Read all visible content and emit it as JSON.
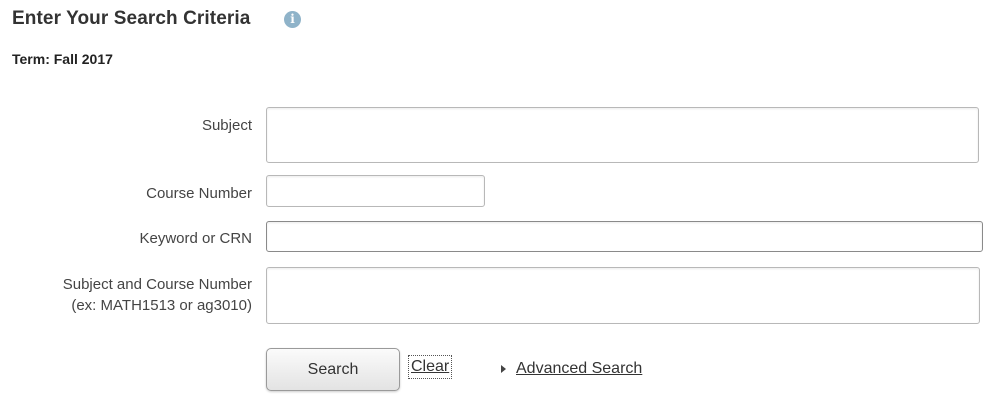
{
  "header": {
    "title": "Enter Your Search Criteria",
    "info_icon": "info-icon"
  },
  "term": {
    "text": "Term: Fall 2017"
  },
  "form": {
    "subject": {
      "label": "Subject",
      "value": ""
    },
    "course_number": {
      "label": "Course Number",
      "value": ""
    },
    "keyword": {
      "label": "Keyword or CRN",
      "value": ""
    },
    "subject_course": {
      "label_line1": "Subject and Course Number",
      "label_line2": "(ex: MATH1513 or ag3010)",
      "value": ""
    }
  },
  "actions": {
    "search_label": "Search",
    "clear_label": "Clear",
    "advanced_label": "Advanced Search"
  }
}
